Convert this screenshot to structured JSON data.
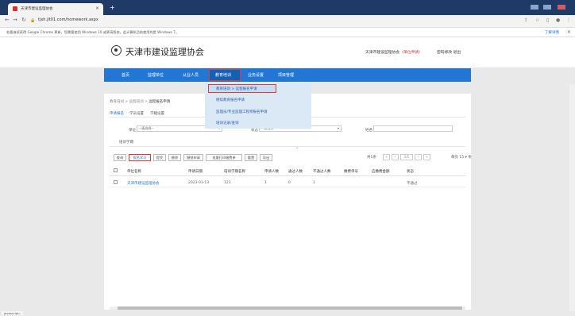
{
  "browser": {
    "tab_title": "天津市建设监理协会",
    "tab_close": "×",
    "new_tab": "+",
    "url": "tjxh.jlt01.com/homework.aspx",
    "info_text": "若要继续获得 Google Chrome 更新，您需要使用 Windows 10 或更高版本。此计算机目前使用的是 Windows 7。",
    "info_link": "了解详情",
    "info_close": "×"
  },
  "header": {
    "site_title": "天津市建设监理协会",
    "user": "天津市建设监理协会",
    "user_status": "（单位申请）",
    "links": "密码修改  退出"
  },
  "nav": {
    "items": [
      "首页",
      "监理单位",
      "从业人员",
      "教育培训",
      "业务设置",
      "项目管理"
    ],
    "active": "教育培训"
  },
  "dropdown": {
    "items": [
      "教育培训 > 远程报名申请",
      "继续教育报名申请",
      "监理员/专业监理工程师报名申请",
      "培训记录/查询"
    ]
  },
  "breadcrumb": {
    "path": "教育培训 > 远程培训 > ",
    "current": "远程报名申请"
  },
  "subtabs": [
    "申请报名",
    "学员设置",
    "学籍设置"
  ],
  "filters": {
    "unit_label": "单位",
    "unit_value": "--请选择--",
    "status_label": "状态",
    "status_value": "--请选择--",
    "name_label": "姓名",
    "train_label": "培训学期"
  },
  "toolbar": {
    "buttons": [
      "查询",
      "报名学习",
      "提交",
      "删除",
      "撤销申请",
      "批量打印缴费单",
      "重置",
      "导出"
    ],
    "pager_text": "共1条",
    "page_buttons": [
      "«",
      "‹",
      "1/1",
      "›",
      "»"
    ],
    "per_page": "每页 15 ▾ 条"
  },
  "table": {
    "headers": [
      "单位名称",
      "申请日期",
      "培训学期名称",
      "申请人数",
      "通过人数",
      "不通过人数",
      "缴费单号",
      "应缴费金额",
      "状态"
    ],
    "rows": [
      [
        "天津市建设监理协会",
        "2023-03-13",
        "123",
        "1",
        "0",
        "1",
        "",
        "",
        "不通过"
      ]
    ]
  },
  "statusbar": {
    "text": "javascript:;"
  }
}
